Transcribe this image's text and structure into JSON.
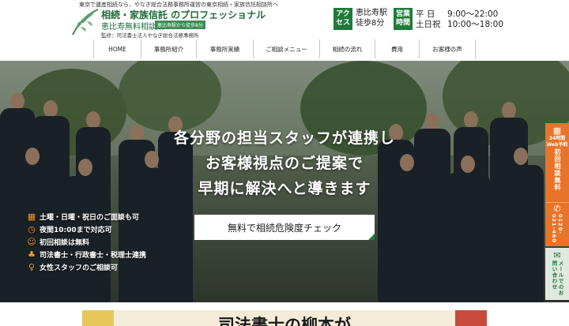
{
  "header": {
    "tagline": "東京で遺産相続なら、やなぎ総合法務事務所運営の東京相続・家族信託相談所へ",
    "title": "相続・家族信託 のプロフェッショナル",
    "subtitle": "恵比寿無料相談所",
    "badge": "恵比寿駅から徒歩8分",
    "supervisor": "監修：司法書士法人やなぎ総合法務事務所",
    "access": {
      "label": "アクセス",
      "station": "恵比寿駅",
      "walk": "徒歩8分"
    },
    "hours": {
      "label": "営業時間",
      "weekday_day": "平 日",
      "weekday_time": "9:00〜22:00",
      "weekend_day": "土日祝",
      "weekend_time": "10:00〜18:00"
    }
  },
  "nav": {
    "items": [
      {
        "label": "HOME"
      },
      {
        "label": "事務所紹介"
      },
      {
        "label": "事務所実績"
      },
      {
        "label": "ご相談メニュー"
      },
      {
        "label": "相続の流れ"
      },
      {
        "label": "費用"
      },
      {
        "label": "お客様の声"
      }
    ]
  },
  "hero": {
    "line1": "各分野の担当スタッフが連携し",
    "line2": "お客様視点のご提案で",
    "line3": "早期に解決へと導きます",
    "cta": "無料で相続危険度チェック",
    "features": [
      {
        "icon": "calendar-icon",
        "text": "土曜・日曜・祝日のご面談も可"
      },
      {
        "icon": "clock-icon",
        "text": "夜間10:00まで対応可"
      },
      {
        "icon": "smile-icon",
        "text": "初回相談は無料"
      },
      {
        "icon": "group-icon",
        "text": "司法書士・行政書士・税理士連携"
      },
      {
        "icon": "woman-icon",
        "text": "女性スタッフのご相談可"
      }
    ]
  },
  "side": {
    "web_line1": "24時間",
    "web_line2": "Web予約",
    "web_vertical": "初回相談無料",
    "tel_vertical": "0120-021-460",
    "mail_vertical": "メールでのお問い合わせ"
  },
  "teaser": {
    "text": "司法書士の柳本が"
  },
  "colors": {
    "brand_green": "#1f7a3a",
    "accent_orange": "#e8742a"
  }
}
